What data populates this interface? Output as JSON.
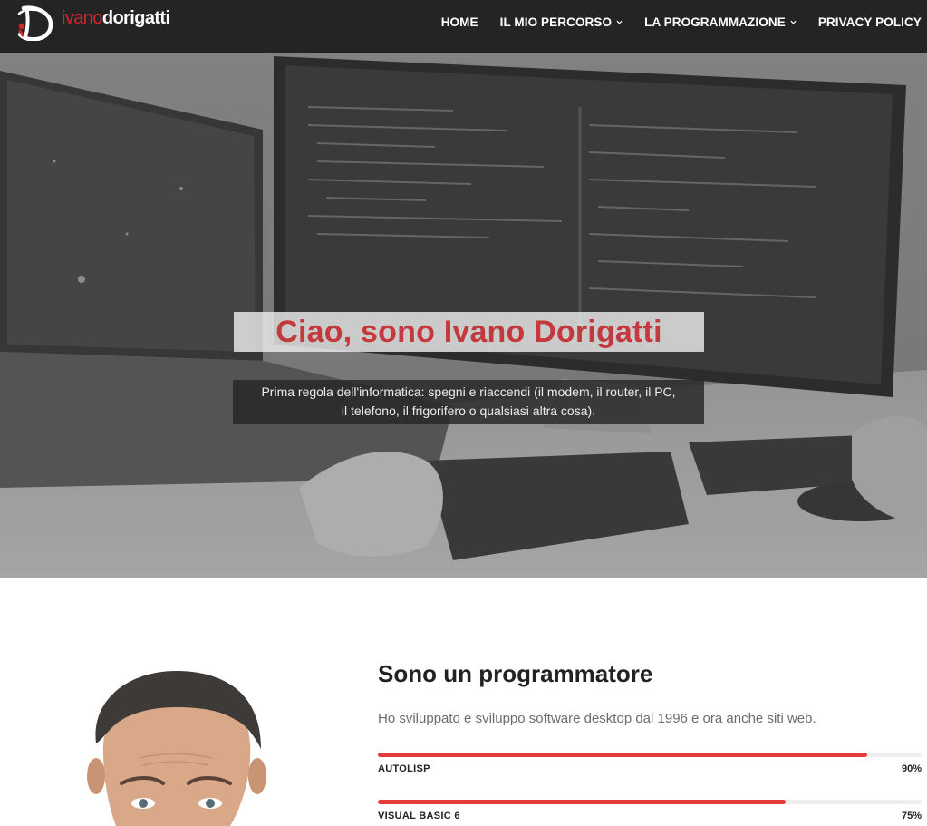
{
  "brand": {
    "first": "ivano",
    "last": "dorigatti",
    "accent": "#d5262c"
  },
  "nav": {
    "items": [
      {
        "label": "HOME",
        "has_dropdown": false
      },
      {
        "label": "IL MIO PERCORSO",
        "has_dropdown": true
      },
      {
        "label": "LA PROGRAMMAZIONE",
        "has_dropdown": true
      },
      {
        "label": "PRIVACY POLICY",
        "has_dropdown": false
      }
    ]
  },
  "hero": {
    "title": "Ciao, sono Ivano Dorigatti",
    "subtitle_line1": "Prima regola dell'informatica: spegni e riaccendi (il modem, il router, il PC,",
    "subtitle_line2": "il telefono, il frigorifero o qualsiasi altra cosa).",
    "title_color": "#c4393d"
  },
  "about": {
    "title": "Sono un programmatore",
    "description": "Ho sviluppato e sviluppo software desktop dal 1996 e ora anche siti web.",
    "skills": [
      {
        "name": "AUTOLISP",
        "percent_label": "90%",
        "value": 0.9
      },
      {
        "name": "VISUAL BASIC 6",
        "percent_label": "75%",
        "value": 0.75
      }
    ],
    "bar_color": "#e8393d"
  }
}
